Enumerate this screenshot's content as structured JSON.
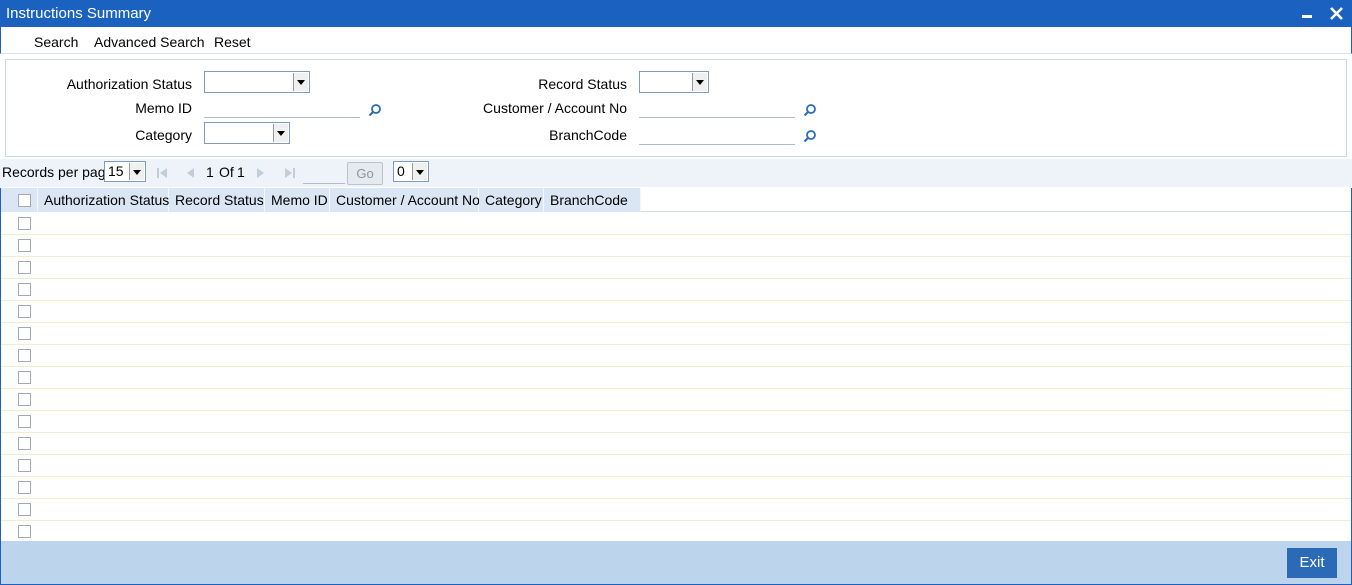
{
  "window": {
    "title": "Instructions Summary",
    "minimize_icon": "minimize-icon",
    "close_icon": "close-icon"
  },
  "menu": {
    "search": "Search",
    "advanced_search": "Advanced Search",
    "reset": "Reset"
  },
  "criteria": {
    "authorization_status": {
      "label": "Authorization Status",
      "value": ""
    },
    "record_status": {
      "label": "Record Status",
      "value": ""
    },
    "memo_id": {
      "label": "Memo ID",
      "value": ""
    },
    "customer_account_no": {
      "label": "Customer / Account No",
      "value": ""
    },
    "category": {
      "label": "Category",
      "value": ""
    },
    "branch_code": {
      "label": "BranchCode",
      "value": ""
    },
    "lookup_icon": "magnifier-icon"
  },
  "pager": {
    "records_per_page_label": "Records per page",
    "records_per_page_value": "15",
    "current_page": "1",
    "of_label": "Of",
    "total_pages": "1",
    "go_label": "Go",
    "goto_value": "",
    "extra_select_value": "0"
  },
  "grid": {
    "columns": [
      "Authorization Status",
      "Record Status",
      "Memo ID",
      "Customer / Account No",
      "Category",
      "BranchCode"
    ],
    "row_count": 15
  },
  "footer": {
    "exit_label": "Exit"
  },
  "colors": {
    "title_bar": "#1b61c0",
    "header_cell": "#dbe6f5",
    "footer": "#bcd4ec",
    "exit_button": "#2b6ab7"
  }
}
